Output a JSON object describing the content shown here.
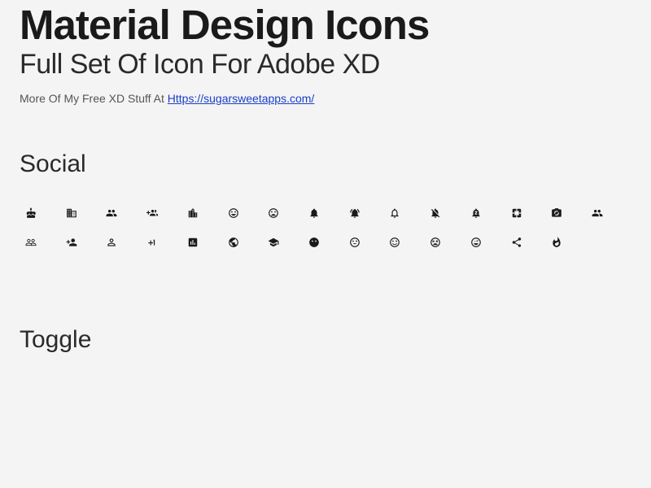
{
  "header": {
    "title": "Material Design Icons",
    "subtitle": "Full Set Of Icon For Adobe XD",
    "credit_prefix": "More Of My Free XD Stuff At ",
    "credit_link_text": "Https://sugarsweetapps.com/",
    "credit_link_href": "https://sugarsweetapps.com/"
  },
  "sections": {
    "social": {
      "title": "Social"
    },
    "toggle": {
      "title": "Toggle"
    }
  }
}
